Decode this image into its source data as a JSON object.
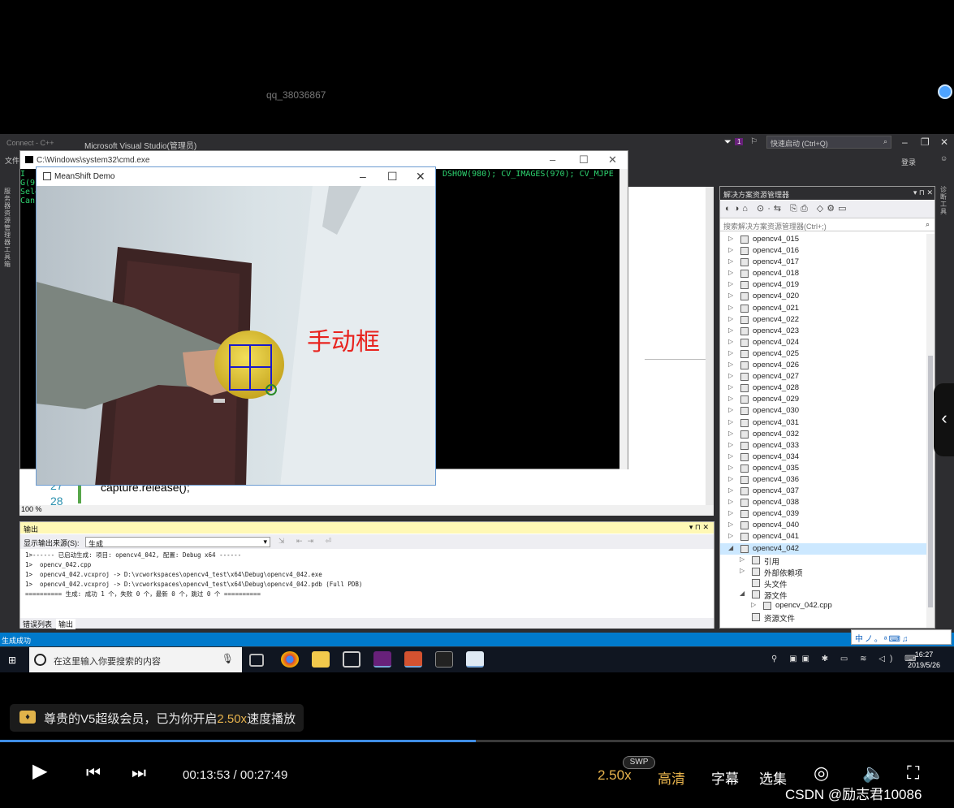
{
  "top": {
    "watermark": "qq_38036867"
  },
  "vs": {
    "title": "Microsoft Visual Studio(管理员)",
    "title_prefix": "Connect - C++",
    "quick_launch_placeholder": "快速启动 (Ctrl+Q)",
    "notif_count": "1",
    "menu_file": "文件",
    "login": "登录",
    "left_strip": "服务器资源管理器 工具箱",
    "right_strip": "诊断工具",
    "zoom": "100 %",
    "line_numbers": [
      "27",
      "28"
    ],
    "code_line": "capture.release();"
  },
  "cmd": {
    "title": "C:\\Windows\\system32\\cmd.exe",
    "text": "DSHOW(980); CV_IMAGES(970); CV_MJPE",
    "left_lines": [
      "I",
      "G(9",
      "Sele",
      "Canc"
    ]
  },
  "meanshift": {
    "title": "MeanShift Demo",
    "annotation": "手动框"
  },
  "solution": {
    "header": "解决方案资源管理器",
    "search_placeholder": "搜索解决方案资源管理器(Ctrl+;)",
    "projects": [
      "opencv4_015",
      "opencv4_016",
      "opencv4_017",
      "opencv4_018",
      "opencv4_019",
      "opencv4_020",
      "opencv4_021",
      "opencv4_022",
      "opencv4_023",
      "opencv4_024",
      "opencv4_025",
      "opencv4_026",
      "opencv4_027",
      "opencv4_028",
      "opencv4_029",
      "opencv4_030",
      "opencv4_031",
      "opencv4_032",
      "opencv4_033",
      "opencv4_034",
      "opencv4_035",
      "opencv4_036",
      "opencv4_037",
      "opencv4_038",
      "opencv4_039",
      "opencv4_040",
      "opencv4_041"
    ],
    "selected_project": "opencv4_042",
    "children": {
      "references": "引用",
      "external_deps": "外部依赖项",
      "headers": "头文件",
      "sources": "源文件",
      "source_file": "opencv_042.cpp",
      "resources": "资源文件"
    }
  },
  "output": {
    "header": "输出",
    "show_from_label": "显示输出来源(S):",
    "show_from_value": "生成",
    "lines": [
      "1>------ 已启动生成: 项目: opencv4_042, 配置: Debug x64 ------",
      "1>  opencv_042.cpp",
      "1>  opencv4_042.vcxproj -> D:\\vcworkspaces\\opencv4_test\\x64\\Debug\\opencv4_042.exe",
      "1>  opencv4_042.vcxproj -> D:\\vcworkspaces\\opencv4_test\\x64\\Debug\\opencv4_042.pdb (Full PDB)",
      "========== 生成: 成功 1 个，失败 0 个，最新 0 个，跳过 0 个 =========="
    ],
    "tab_errors": "错误列表",
    "tab_output": "输出"
  },
  "status": {
    "text": "生成成功"
  },
  "ime": {
    "text": "中ノ。ᵃ⌨♫"
  },
  "taskbar": {
    "search_placeholder": "在这里输入你要搜索的内容",
    "time": "16:27",
    "date": "2019/5/26"
  },
  "player": {
    "vip_text_pre": "尊贵的V5超级会员，已为你开启",
    "vip_speed": "2.50x",
    "vip_text_post": "速度播放",
    "current_time": "00:13:53",
    "total_time": "00:27:49",
    "progress_fraction": 0.499,
    "speed": "2.50x",
    "swp_badge": "SWP",
    "quality": "高清",
    "subtitle": "字幕",
    "episodes": "选集",
    "csdn": "CSDN @励志君10086"
  },
  "colors": {
    "accent_blue": "#007acc",
    "gold": "#e7b34d",
    "annotation_red": "#e8241f"
  }
}
